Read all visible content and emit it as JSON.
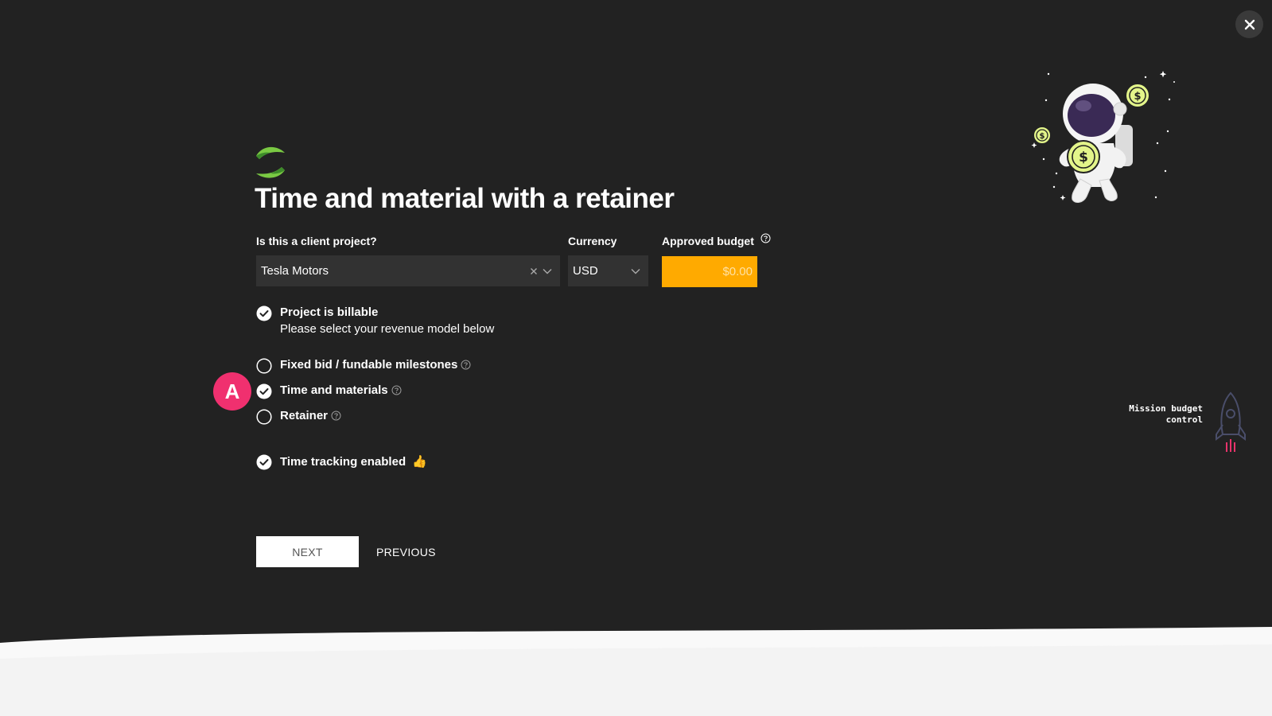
{
  "title": "Time and material with a retainer",
  "client": {
    "label": "Is this a client project?",
    "value": "Tesla Motors"
  },
  "currency": {
    "label": "Currency",
    "value": "USD"
  },
  "budget": {
    "label": "Approved budget",
    "placeholder": "$0.00"
  },
  "billable": {
    "label": "Project is billable",
    "subtext": "Please select your revenue model below",
    "checked": true
  },
  "revenue_models": [
    {
      "label": "Fixed bid / fundable milestones",
      "selected": false
    },
    {
      "label": "Time and materials",
      "selected": true
    },
    {
      "label": "Retainer",
      "selected": false
    }
  ],
  "time_tracking": {
    "label": "Time tracking enabled",
    "emoji": "👍",
    "checked": true
  },
  "avatar": {
    "initial": "A",
    "color": "#f0306f"
  },
  "buttons": {
    "next": "NEXT",
    "previous": "PREVIOUS"
  },
  "mission": {
    "line1": "Mission budget",
    "line2": "control"
  },
  "colors": {
    "background": "#222222",
    "accent_budget": "#ffaa00",
    "coin": "#e3f58a",
    "rocket_flame": "#e8336b"
  },
  "icons": {
    "close": "close-icon",
    "help": "question-circle-icon",
    "check": "check-circle-icon",
    "radio": "radio-empty-icon",
    "chevron": "chevron-down-icon",
    "clear": "clear-x-icon"
  }
}
